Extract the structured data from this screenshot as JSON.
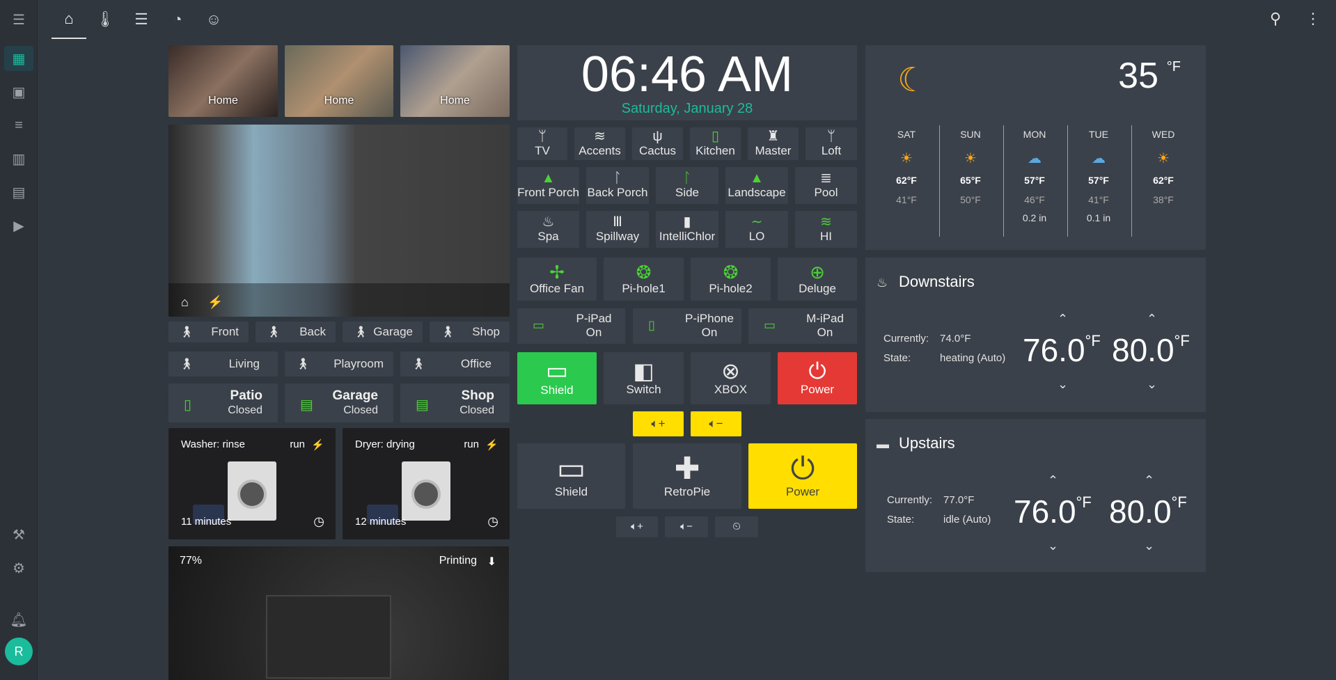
{
  "sidebar": {
    "avatar_initial": "R"
  },
  "tabs": [
    "home",
    "thermostat",
    "server",
    "gauge",
    "robot"
  ],
  "cameras": [
    {
      "label": "Home"
    },
    {
      "label": "Home"
    },
    {
      "label": "Home"
    }
  ],
  "motion": [
    {
      "label": "Front"
    },
    {
      "label": "Back"
    },
    {
      "label": "Garage"
    },
    {
      "label": "Shop"
    }
  ],
  "rooms": [
    {
      "label": "Living"
    },
    {
      "label": "Playroom"
    },
    {
      "label": "Office"
    }
  ],
  "doors": [
    {
      "title": "Patio",
      "state": "Closed"
    },
    {
      "title": "Garage",
      "state": "Closed"
    },
    {
      "title": "Shop",
      "state": "Closed"
    }
  ],
  "washer": {
    "status": "Washer: rinse",
    "mode": "run",
    "remaining": "11 minutes"
  },
  "dryer": {
    "status": "Dryer: drying",
    "mode": "run",
    "remaining": "12 minutes"
  },
  "printer": {
    "progress": "77%",
    "state": "Printing",
    "progress_value": 77
  },
  "clock": {
    "time": "06:46 AM",
    "date": "Saturday, January 28"
  },
  "lights_row1": [
    "TV",
    "Accents",
    "Cactus",
    "Kitchen",
    "Master",
    "Loft"
  ],
  "lights_row2": [
    "Front Porch",
    "Back Porch",
    "Side",
    "Landscape",
    "Pool"
  ],
  "lights_row3": [
    "Spa",
    "Spillway",
    "IntelliChlor",
    "LO",
    "HI"
  ],
  "devices": [
    "Office Fan",
    "Pi-hole1",
    "Pi-hole2",
    "Deluge"
  ],
  "trackers": [
    {
      "name": "P-iPad",
      "state": "On"
    },
    {
      "name": "P-iPhone",
      "state": "On"
    },
    {
      "name": "M-iPad",
      "state": "On"
    }
  ],
  "media1": [
    "Shield",
    "Switch",
    "XBOX",
    "Power"
  ],
  "media2": [
    "Shield",
    "RetroPie",
    "Power"
  ],
  "weather": {
    "temp": "35",
    "unit": "°F",
    "days": [
      {
        "name": "SAT",
        "high": "62°F",
        "low": "41°F",
        "precip": "",
        "icon": "sun"
      },
      {
        "name": "SUN",
        "high": "65°F",
        "low": "50°F",
        "precip": "",
        "icon": "sun"
      },
      {
        "name": "MON",
        "high": "57°F",
        "low": "46°F",
        "precip": "0.2 in",
        "icon": "cloud-rain"
      },
      {
        "name": "TUE",
        "high": "57°F",
        "low": "41°F",
        "precip": "0.1 in",
        "icon": "cloud-rain"
      },
      {
        "name": "WED",
        "high": "62°F",
        "low": "38°F",
        "precip": "",
        "icon": "sun"
      }
    ]
  },
  "downstairs": {
    "title": "Downstairs",
    "currently_label": "Currently:",
    "currently": "74.0°F",
    "state_label": "State:",
    "state": "heating (Auto)",
    "low": "76.0",
    "high": "80.0",
    "unit": "°F"
  },
  "upstairs": {
    "title": "Upstairs",
    "currently_label": "Currently:",
    "currently": "77.0°F",
    "state_label": "State:",
    "state": "idle (Auto)",
    "low": "76.0",
    "high": "80.0",
    "unit": "°F"
  }
}
